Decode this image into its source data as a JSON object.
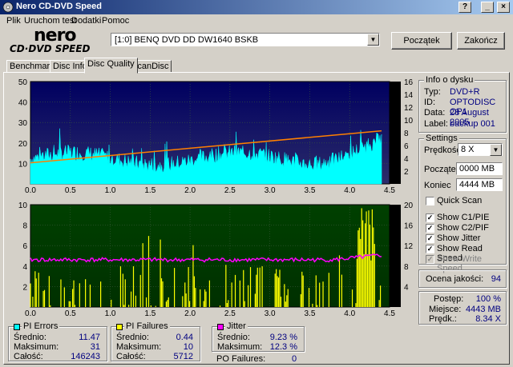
{
  "window": {
    "title": "Nero CD-DVD Speed"
  },
  "menu": [
    "Plik",
    "Uruchom test",
    "Dodatki",
    "Pomoc"
  ],
  "logo": {
    "line1": "nero",
    "line2": "CD·DVD SPEED"
  },
  "drive": {
    "selected": "[1:0]   BENQ DVD DD DW1640 BSKB"
  },
  "buttons": {
    "start": "Początek",
    "end": "Zakończ"
  },
  "tabs": [
    "Benchmark",
    "Disc Info",
    "Disc Quality",
    "ScanDisc"
  ],
  "disc_info": {
    "title": "Info o dysku",
    "type_label": "Typ:",
    "type": "DVD+R",
    "id_label": "ID:",
    "id": "OPTODISC OP1",
    "date_label": "Data:",
    "date": "28 August 2005",
    "label_label": "Label:",
    "label": "backup 001"
  },
  "settings": {
    "title": "Settings",
    "speed_label": "Prędkość",
    "speed": "8 X",
    "start_label": "Początek",
    "start": "0000 MB",
    "end_label": "Koniec",
    "end": "4444 MB",
    "quick_scan": "Quick Scan",
    "show_c1": "Show C1/PIE",
    "show_c2": "Show C2/PIF",
    "show_jitter": "Show Jitter",
    "show_read": "Show Read Speed",
    "show_write": "Show Write Speed"
  },
  "quality": {
    "label": "Ocena jakości:",
    "value": "94"
  },
  "progress": {
    "postep_label": "Postęp:",
    "postep": "100 %",
    "miejsce_label": "Miejsce:",
    "miejsce": "4443 MB",
    "predk_label": "Prędk.:",
    "predk": "8.34 X"
  },
  "stats": {
    "pi_errors": {
      "title": "PI Errors",
      "avg_label": "Średnio:",
      "avg": "11.47",
      "max_label": "Maksimum:",
      "max": "31",
      "total_label": "Całość:",
      "total": "146243",
      "color": "#00ffff"
    },
    "pi_failures": {
      "title": "PI Failures",
      "avg_label": "Średnio:",
      "avg": "0.44",
      "max_label": "Maksimum:",
      "max": "10",
      "total_label": "Całość:",
      "total": "5712",
      "color": "#ffff00"
    },
    "jitter": {
      "title": "Jitter",
      "avg_label": "Średnio:",
      "avg": "9.23 %",
      "max_label": "Maksimum:",
      "max": "12.3 %",
      "color": "#ff00ff"
    },
    "po_failures_label": "PO Failures:",
    "po_failures": "0"
  },
  "chart_data": [
    {
      "type": "area",
      "name": "PI Errors",
      "x_ticks": [
        "0.0",
        "0.5",
        "1.0",
        "1.5",
        "2.0",
        "2.5",
        "3.0",
        "3.5",
        "4.0",
        "4.5"
      ],
      "y_left_ticks": [
        "50",
        "40",
        "30",
        "20",
        "10"
      ],
      "y_right_ticks": [
        "16",
        "14",
        "12",
        "10",
        "8",
        "6",
        "4",
        "2"
      ],
      "xlim": [
        0,
        4.5
      ],
      "ylim_left": [
        0,
        50
      ],
      "ylim_right": [
        0,
        16
      ],
      "series": [
        {
          "name": "PIE",
          "color": "#00ffff",
          "approx_level": 11.47,
          "max": 31
        },
        {
          "name": "Read speed",
          "color": "#ff8000",
          "x": [
            0.0,
            4.4
          ],
          "y": [
            3.3,
            8.3
          ]
        }
      ]
    },
    {
      "type": "bar",
      "name": "PI Failures",
      "x_ticks": [
        "0.0",
        "0.5",
        "1.0",
        "1.5",
        "2.0",
        "2.5",
        "3.0",
        "3.5",
        "4.0",
        "4.5"
      ],
      "y_left_ticks": [
        "10",
        "8",
        "6",
        "4",
        "2"
      ],
      "y_right_ticks": [
        "20",
        "16",
        "12",
        "8",
        "4"
      ],
      "xlim": [
        0,
        4.5
      ],
      "ylim_left": [
        0,
        10
      ],
      "ylim_right": [
        0,
        20
      ],
      "series": [
        {
          "name": "PIF",
          "color": "#ffff00",
          "max": 10
        },
        {
          "name": "Jitter",
          "color": "#ff00ff",
          "approx_level": 9.23
        }
      ]
    }
  ]
}
